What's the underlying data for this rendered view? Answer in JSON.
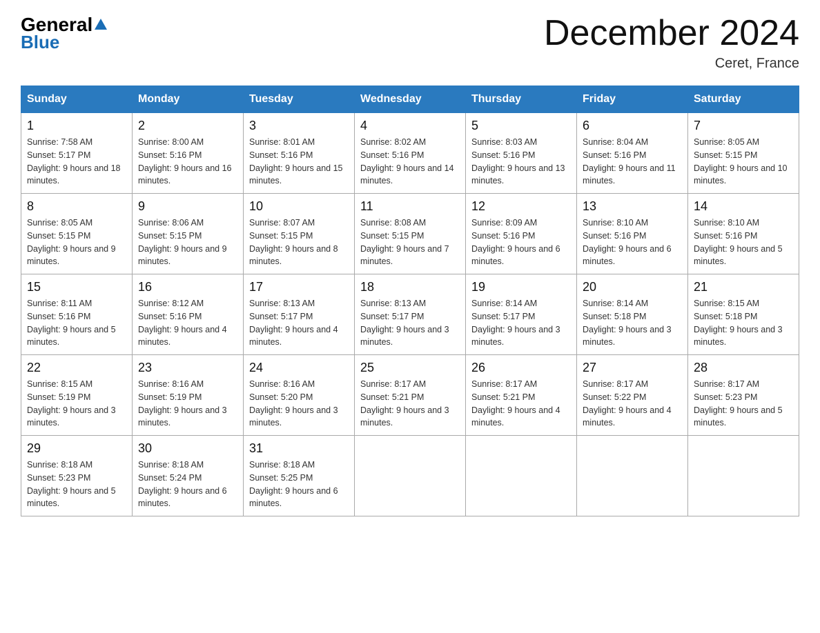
{
  "header": {
    "logo_general": "General",
    "logo_blue": "Blue",
    "title": "December 2024",
    "location": "Ceret, France"
  },
  "weekdays": [
    "Sunday",
    "Monday",
    "Tuesday",
    "Wednesday",
    "Thursday",
    "Friday",
    "Saturday"
  ],
  "weeks": [
    [
      {
        "day": "1",
        "sunrise": "Sunrise: 7:58 AM",
        "sunset": "Sunset: 5:17 PM",
        "daylight": "Daylight: 9 hours and 18 minutes."
      },
      {
        "day": "2",
        "sunrise": "Sunrise: 8:00 AM",
        "sunset": "Sunset: 5:16 PM",
        "daylight": "Daylight: 9 hours and 16 minutes."
      },
      {
        "day": "3",
        "sunrise": "Sunrise: 8:01 AM",
        "sunset": "Sunset: 5:16 PM",
        "daylight": "Daylight: 9 hours and 15 minutes."
      },
      {
        "day": "4",
        "sunrise": "Sunrise: 8:02 AM",
        "sunset": "Sunset: 5:16 PM",
        "daylight": "Daylight: 9 hours and 14 minutes."
      },
      {
        "day": "5",
        "sunrise": "Sunrise: 8:03 AM",
        "sunset": "Sunset: 5:16 PM",
        "daylight": "Daylight: 9 hours and 13 minutes."
      },
      {
        "day": "6",
        "sunrise": "Sunrise: 8:04 AM",
        "sunset": "Sunset: 5:16 PM",
        "daylight": "Daylight: 9 hours and 11 minutes."
      },
      {
        "day": "7",
        "sunrise": "Sunrise: 8:05 AM",
        "sunset": "Sunset: 5:15 PM",
        "daylight": "Daylight: 9 hours and 10 minutes."
      }
    ],
    [
      {
        "day": "8",
        "sunrise": "Sunrise: 8:05 AM",
        "sunset": "Sunset: 5:15 PM",
        "daylight": "Daylight: 9 hours and 9 minutes."
      },
      {
        "day": "9",
        "sunrise": "Sunrise: 8:06 AM",
        "sunset": "Sunset: 5:15 PM",
        "daylight": "Daylight: 9 hours and 9 minutes."
      },
      {
        "day": "10",
        "sunrise": "Sunrise: 8:07 AM",
        "sunset": "Sunset: 5:15 PM",
        "daylight": "Daylight: 9 hours and 8 minutes."
      },
      {
        "day": "11",
        "sunrise": "Sunrise: 8:08 AM",
        "sunset": "Sunset: 5:15 PM",
        "daylight": "Daylight: 9 hours and 7 minutes."
      },
      {
        "day": "12",
        "sunrise": "Sunrise: 8:09 AM",
        "sunset": "Sunset: 5:16 PM",
        "daylight": "Daylight: 9 hours and 6 minutes."
      },
      {
        "day": "13",
        "sunrise": "Sunrise: 8:10 AM",
        "sunset": "Sunset: 5:16 PM",
        "daylight": "Daylight: 9 hours and 6 minutes."
      },
      {
        "day": "14",
        "sunrise": "Sunrise: 8:10 AM",
        "sunset": "Sunset: 5:16 PM",
        "daylight": "Daylight: 9 hours and 5 minutes."
      }
    ],
    [
      {
        "day": "15",
        "sunrise": "Sunrise: 8:11 AM",
        "sunset": "Sunset: 5:16 PM",
        "daylight": "Daylight: 9 hours and 5 minutes."
      },
      {
        "day": "16",
        "sunrise": "Sunrise: 8:12 AM",
        "sunset": "Sunset: 5:16 PM",
        "daylight": "Daylight: 9 hours and 4 minutes."
      },
      {
        "day": "17",
        "sunrise": "Sunrise: 8:13 AM",
        "sunset": "Sunset: 5:17 PM",
        "daylight": "Daylight: 9 hours and 4 minutes."
      },
      {
        "day": "18",
        "sunrise": "Sunrise: 8:13 AM",
        "sunset": "Sunset: 5:17 PM",
        "daylight": "Daylight: 9 hours and 3 minutes."
      },
      {
        "day": "19",
        "sunrise": "Sunrise: 8:14 AM",
        "sunset": "Sunset: 5:17 PM",
        "daylight": "Daylight: 9 hours and 3 minutes."
      },
      {
        "day": "20",
        "sunrise": "Sunrise: 8:14 AM",
        "sunset": "Sunset: 5:18 PM",
        "daylight": "Daylight: 9 hours and 3 minutes."
      },
      {
        "day": "21",
        "sunrise": "Sunrise: 8:15 AM",
        "sunset": "Sunset: 5:18 PM",
        "daylight": "Daylight: 9 hours and 3 minutes."
      }
    ],
    [
      {
        "day": "22",
        "sunrise": "Sunrise: 8:15 AM",
        "sunset": "Sunset: 5:19 PM",
        "daylight": "Daylight: 9 hours and 3 minutes."
      },
      {
        "day": "23",
        "sunrise": "Sunrise: 8:16 AM",
        "sunset": "Sunset: 5:19 PM",
        "daylight": "Daylight: 9 hours and 3 minutes."
      },
      {
        "day": "24",
        "sunrise": "Sunrise: 8:16 AM",
        "sunset": "Sunset: 5:20 PM",
        "daylight": "Daylight: 9 hours and 3 minutes."
      },
      {
        "day": "25",
        "sunrise": "Sunrise: 8:17 AM",
        "sunset": "Sunset: 5:21 PM",
        "daylight": "Daylight: 9 hours and 3 minutes."
      },
      {
        "day": "26",
        "sunrise": "Sunrise: 8:17 AM",
        "sunset": "Sunset: 5:21 PM",
        "daylight": "Daylight: 9 hours and 4 minutes."
      },
      {
        "day": "27",
        "sunrise": "Sunrise: 8:17 AM",
        "sunset": "Sunset: 5:22 PM",
        "daylight": "Daylight: 9 hours and 4 minutes."
      },
      {
        "day": "28",
        "sunrise": "Sunrise: 8:17 AM",
        "sunset": "Sunset: 5:23 PM",
        "daylight": "Daylight: 9 hours and 5 minutes."
      }
    ],
    [
      {
        "day": "29",
        "sunrise": "Sunrise: 8:18 AM",
        "sunset": "Sunset: 5:23 PM",
        "daylight": "Daylight: 9 hours and 5 minutes."
      },
      {
        "day": "30",
        "sunrise": "Sunrise: 8:18 AM",
        "sunset": "Sunset: 5:24 PM",
        "daylight": "Daylight: 9 hours and 6 minutes."
      },
      {
        "day": "31",
        "sunrise": "Sunrise: 8:18 AM",
        "sunset": "Sunset: 5:25 PM",
        "daylight": "Daylight: 9 hours and 6 minutes."
      },
      null,
      null,
      null,
      null
    ]
  ]
}
